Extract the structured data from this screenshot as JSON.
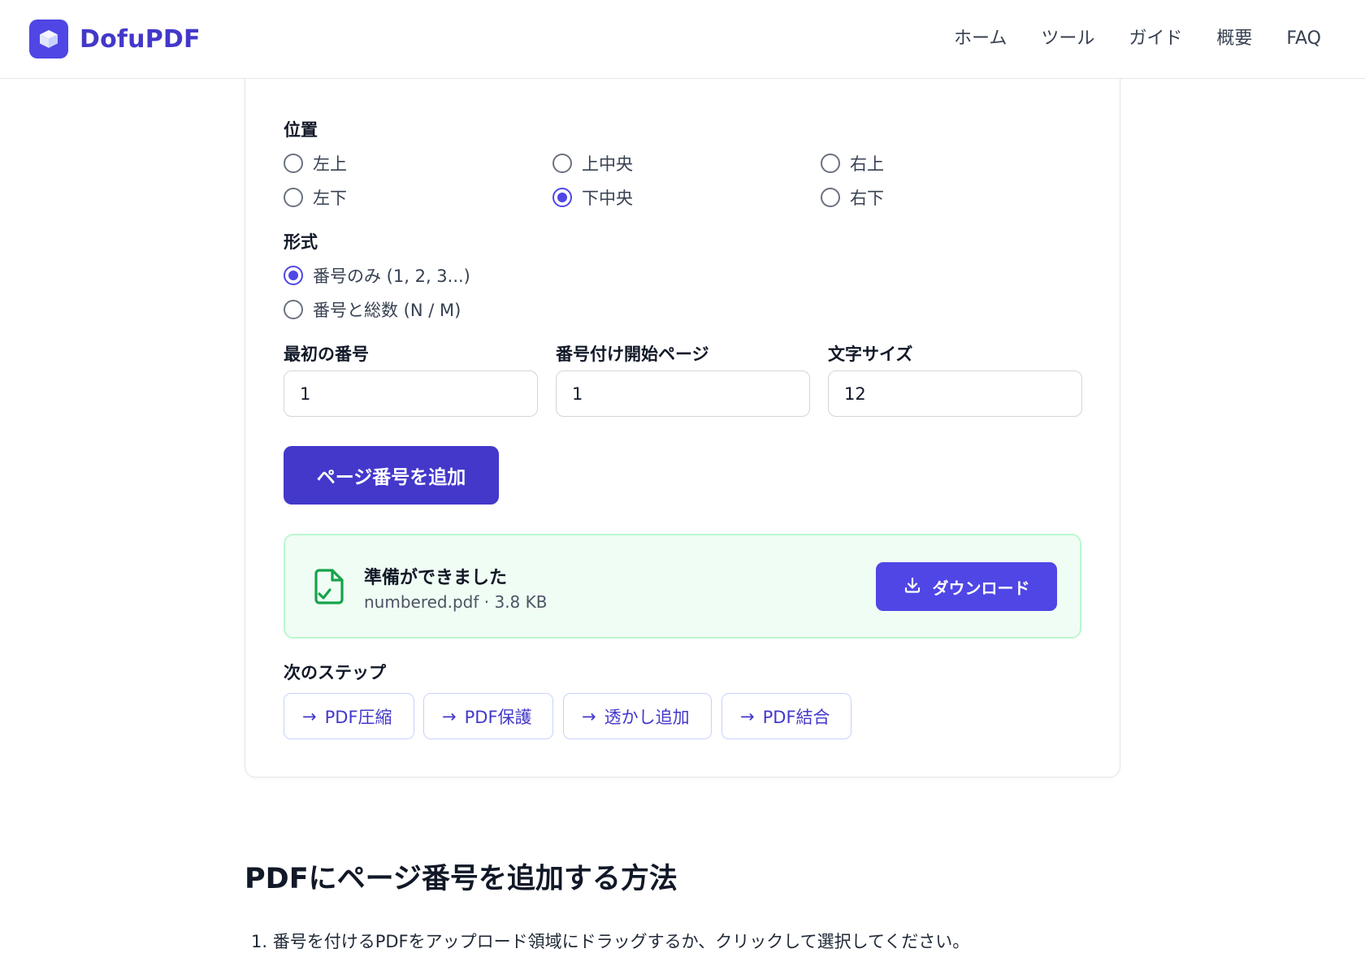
{
  "header": {
    "brand": "DofuPDF",
    "nav": [
      "ホーム",
      "ツール",
      "ガイド",
      "概要",
      "FAQ"
    ]
  },
  "position": {
    "label": "位置",
    "options": [
      "左上",
      "上中央",
      "右上",
      "左下",
      "下中央",
      "右下"
    ],
    "selected": "下中央"
  },
  "format": {
    "label": "形式",
    "options": [
      "番号のみ (1, 2, 3...)",
      "番号と総数 (N / M)"
    ],
    "selected": "番号のみ (1, 2, 3...)"
  },
  "fields": {
    "first_number": {
      "label": "最初の番号",
      "value": "1"
    },
    "start_page": {
      "label": "番号付け開始ページ",
      "value": "1"
    },
    "font_size": {
      "label": "文字サイズ",
      "value": "12"
    }
  },
  "primary_button": "ページ番号を追加",
  "result": {
    "title": "準備ができました",
    "meta": "numbered.pdf · 3.8 KB",
    "download": "ダウンロード"
  },
  "next_steps": {
    "label": "次のステップ",
    "items": [
      "PDF圧縮",
      "PDF保護",
      "透かし追加",
      "PDF結合"
    ]
  },
  "article": {
    "heading": "PDFにページ番号を追加する方法",
    "step1": "1. 番号を付けるPDFをアップロード領域にドラッグするか、クリックして選択してください。"
  },
  "colors": {
    "accent": "#4f46e5",
    "accent_dark": "#4338ca",
    "success_bg": "#f0fdf4",
    "success_icon": "#16a34a"
  }
}
